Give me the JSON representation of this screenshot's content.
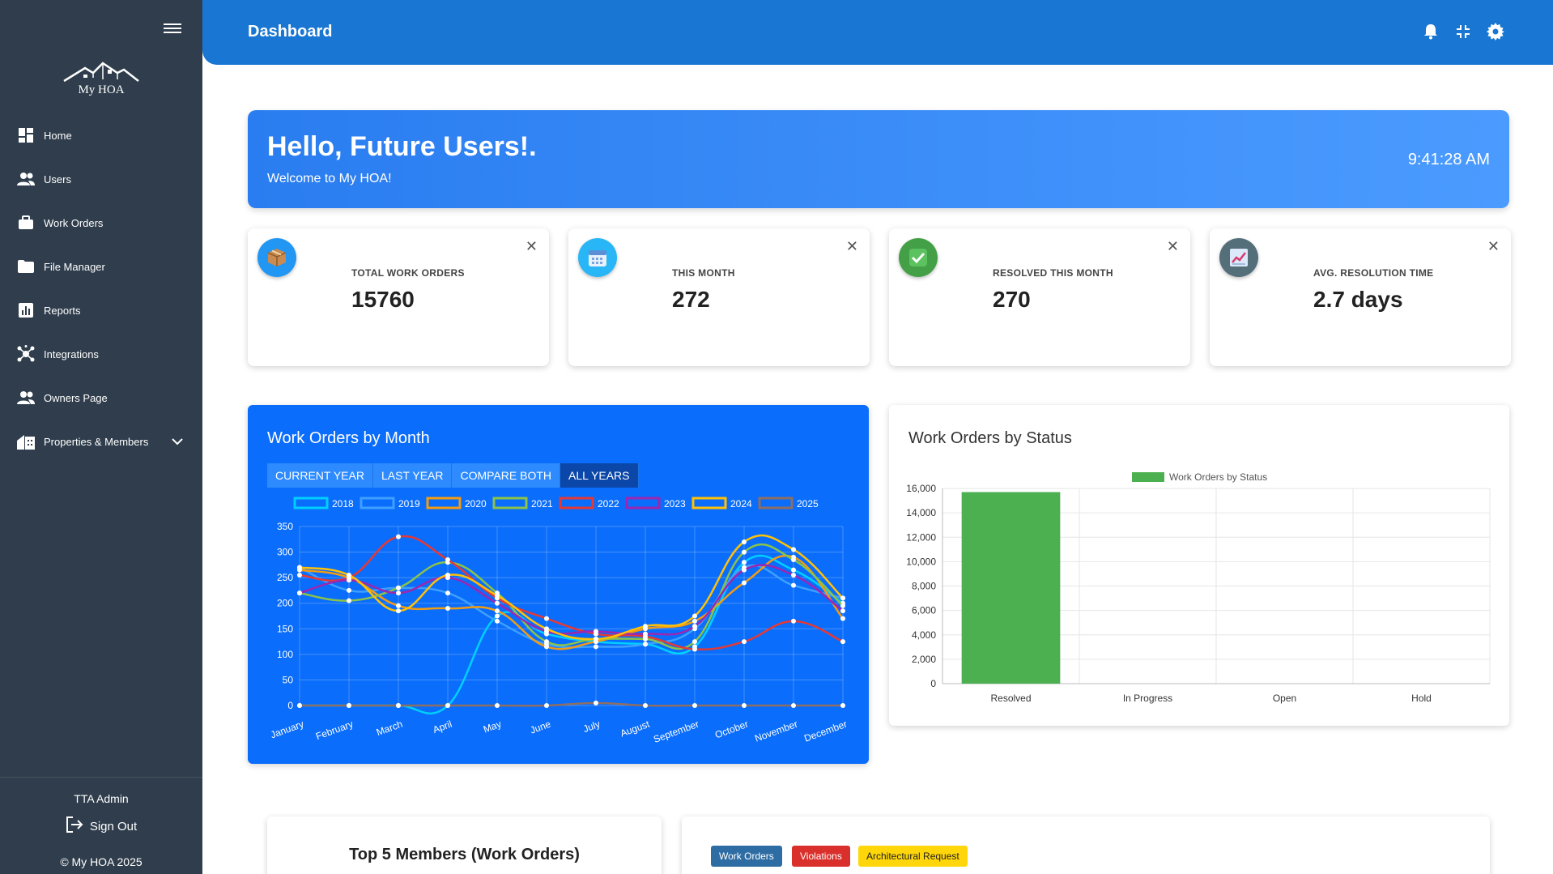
{
  "sidebar": {
    "logo_text": "My HOA",
    "items": [
      {
        "label": "Home",
        "icon": "dashboard-icon"
      },
      {
        "label": "Users",
        "icon": "users-icon"
      },
      {
        "label": "Work Orders",
        "icon": "briefcase-icon"
      },
      {
        "label": "File Manager",
        "icon": "folder-icon"
      },
      {
        "label": "Reports",
        "icon": "bar-chart-icon"
      },
      {
        "label": "Integrations",
        "icon": "hub-icon"
      },
      {
        "label": "Owners Page",
        "icon": "users-icon"
      },
      {
        "label": "Properties & Members",
        "icon": "house-icon"
      }
    ],
    "user_name": "TTA Admin",
    "sign_out": "Sign Out",
    "copyright": "© My HOA 2025"
  },
  "header": {
    "title": "Dashboard",
    "icons": [
      "bell-icon",
      "fullscreen-exit-icon",
      "gear-icon"
    ]
  },
  "banner": {
    "greeting": "Hello, Future Users!.",
    "subtitle": "Welcome to My HOA!",
    "time": "9:41:28 AM"
  },
  "stats": [
    {
      "label": "TOTAL WORK ORDERS",
      "value": "15760",
      "icon": "package-icon",
      "color": "#2196f3"
    },
    {
      "label": "THIS MONTH",
      "value": "272",
      "icon": "calendar-icon",
      "color": "#29b6f6"
    },
    {
      "label": "RESOLVED THIS MONTH",
      "value": "270",
      "icon": "checkmark-icon",
      "color": "#43a047"
    },
    {
      "label": "AVG. RESOLUTION TIME",
      "value": "2.7 days",
      "icon": "trend-chart-icon",
      "color": "#546e7a"
    }
  ],
  "monthly": {
    "title": "Work Orders by Month",
    "tabs": [
      "CURRENT YEAR",
      "LAST YEAR",
      "COMPARE BOTH",
      "ALL YEARS"
    ],
    "active_tab": "ALL YEARS"
  },
  "status": {
    "title": "Work Orders by Status"
  },
  "bottom": {
    "top_members_title": "Top 5 Members (Work Orders)",
    "pills": [
      {
        "label": "Work Orders",
        "bg": "#2e6da4",
        "fg": "#ffffff"
      },
      {
        "label": "Violations",
        "bg": "#d9302c",
        "fg": "#ffffff"
      },
      {
        "label": "Architectural Request",
        "bg": "#ffd60a",
        "fg": "#222222"
      }
    ]
  },
  "chart_data": [
    {
      "type": "line",
      "title": "Work Orders by Month",
      "categories": [
        "January",
        "February",
        "March",
        "April",
        "May",
        "June",
        "July",
        "August",
        "September",
        "October",
        "November",
        "December"
      ],
      "ylim": [
        0,
        350
      ],
      "yticks": [
        0,
        50,
        100,
        150,
        200,
        250,
        300,
        350
      ],
      "grid": true,
      "legend_position": "top",
      "series": [
        {
          "name": "2018",
          "color": "#00d0ff",
          "values": [
            0,
            0,
            0,
            0,
            175,
            140,
            125,
            120,
            115,
            280,
            265,
            200
          ]
        },
        {
          "name": "2019",
          "color": "#3ea0ff",
          "values": [
            270,
            225,
            230,
            220,
            165,
            120,
            115,
            120,
            150,
            270,
            235,
            210
          ]
        },
        {
          "name": "2020",
          "color": "#f39c12",
          "values": [
            265,
            250,
            195,
            190,
            185,
            115,
            125,
            150,
            165,
            240,
            290,
            170
          ]
        },
        {
          "name": "2021",
          "color": "#8bc34a",
          "values": [
            220,
            205,
            230,
            280,
            220,
            125,
            130,
            130,
            125,
            300,
            285,
            195
          ]
        },
        {
          "name": "2022",
          "color": "#e53935",
          "values": [
            255,
            250,
            330,
            285,
            210,
            170,
            140,
            135,
            110,
            125,
            165,
            125
          ]
        },
        {
          "name": "2023",
          "color": "#9c27b0",
          "values": [
            220,
            245,
            220,
            250,
            200,
            145,
            145,
            140,
            155,
            265,
            255,
            185
          ]
        },
        {
          "name": "2024",
          "color": "#ffc107",
          "values": [
            270,
            255,
            185,
            255,
            215,
            150,
            130,
            155,
            175,
            320,
            305,
            210
          ]
        },
        {
          "name": "2025",
          "color": "#8d6e63",
          "values": [
            0,
            0,
            0,
            0,
            0,
            0,
            5,
            0,
            0,
            0,
            0,
            0
          ]
        }
      ]
    },
    {
      "type": "bar",
      "title": "Work Orders by Status",
      "categories": [
        "Resolved",
        "In Progress",
        "Open",
        "Hold"
      ],
      "series": [
        {
          "name": "Work Orders by Status",
          "color": "#4caf50",
          "values": [
            15700,
            0,
            0,
            0
          ]
        }
      ],
      "ylim": [
        0,
        16000
      ],
      "yticks": [
        0,
        2000,
        4000,
        6000,
        8000,
        10000,
        12000,
        14000,
        16000
      ],
      "grid": true,
      "legend_position": "top"
    }
  ]
}
